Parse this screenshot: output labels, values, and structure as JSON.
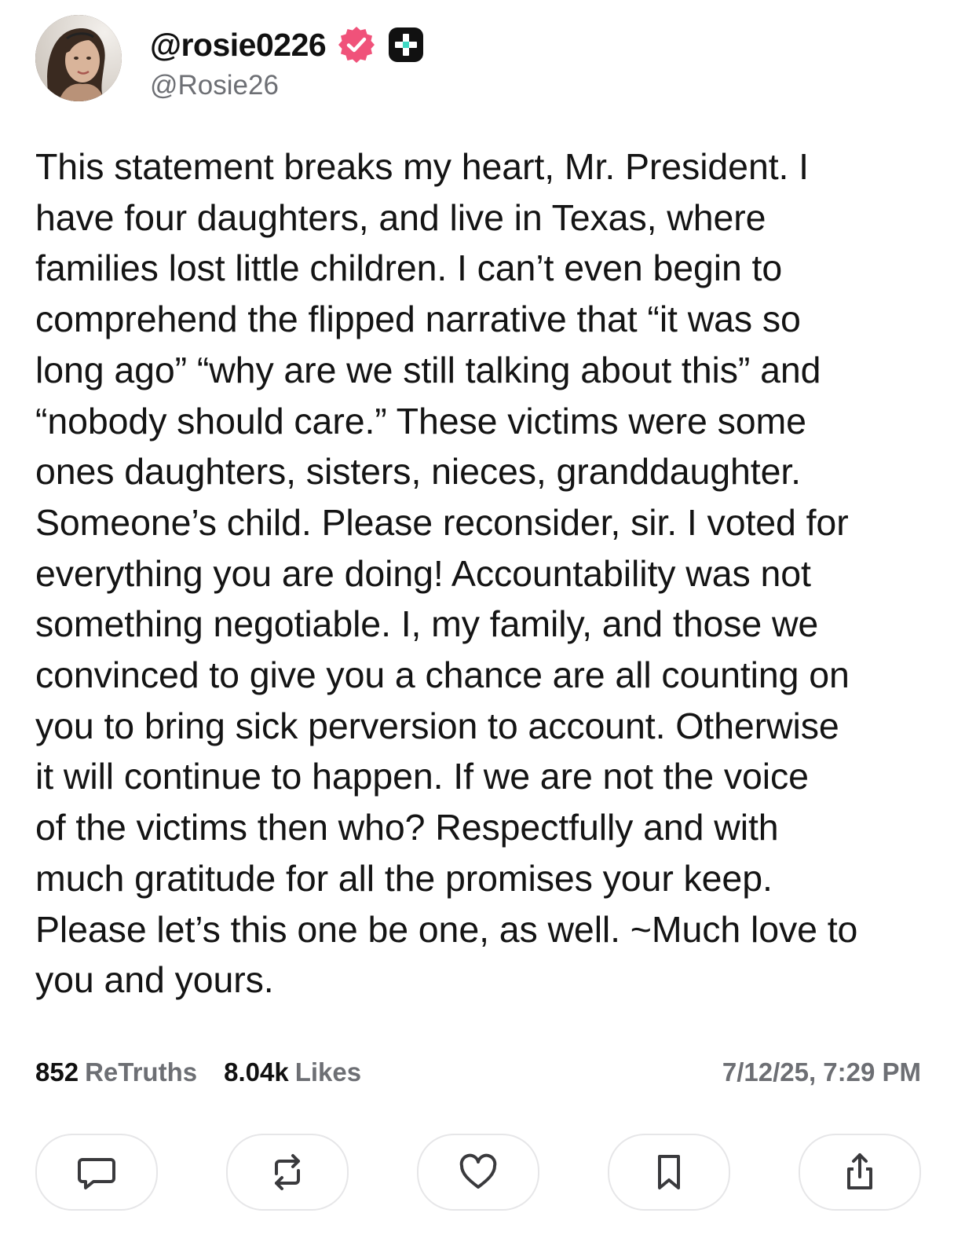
{
  "author": {
    "display_name": "@rosie0226",
    "handle": "@Rosie26",
    "avatar_icon": "user-photo-avatar",
    "verified_icon": "verified-badge-icon",
    "verified_color": "#f0527a",
    "plus_badge_icon": "plus-badge-icon"
  },
  "post": {
    "lines": [
      "This statement breaks my heart, Mr. President. I",
      "have four daughters, and live in Texas, where",
      "families lost little children. I can’t even begin to",
      "comprehend the flipped narrative that “it was so",
      "long ago” “why are we still talking about this” and",
      "“nobody should care.” These victims were some",
      "ones daughters, sisters, nieces, granddaughter.",
      "Someone’s child. Please reconsider, sir. I voted for",
      "everything you are doing! Accountability was not",
      "something negotiable. I, my family, and those we",
      "convinced to give you a chance are all counting on",
      "you to bring sick perversion to account. Otherwise",
      "it will continue to happen. If we are not the voice",
      "of the victims then who? Respectfully and with",
      "much gratitude for all the promises your keep.",
      "Please let’s this one be one, as well. ~Much love to",
      "you and yours."
    ]
  },
  "stats": {
    "retruths_count": "852",
    "retruths_label": "ReTruths",
    "likes_count": "8.04k",
    "likes_label": "Likes",
    "timestamp": "7/12/25, 7:29 PM"
  },
  "actions": [
    {
      "name": "reply",
      "icon": "comment-icon"
    },
    {
      "name": "retruth",
      "icon": "repost-icon"
    },
    {
      "name": "like",
      "icon": "heart-icon"
    },
    {
      "name": "bookmark",
      "icon": "bookmark-icon"
    },
    {
      "name": "share",
      "icon": "share-icon"
    }
  ],
  "colors": {
    "text": "#141414",
    "muted": "#6d6f74",
    "border": "#e6e6e8",
    "icon": "#3a3a3d"
  }
}
